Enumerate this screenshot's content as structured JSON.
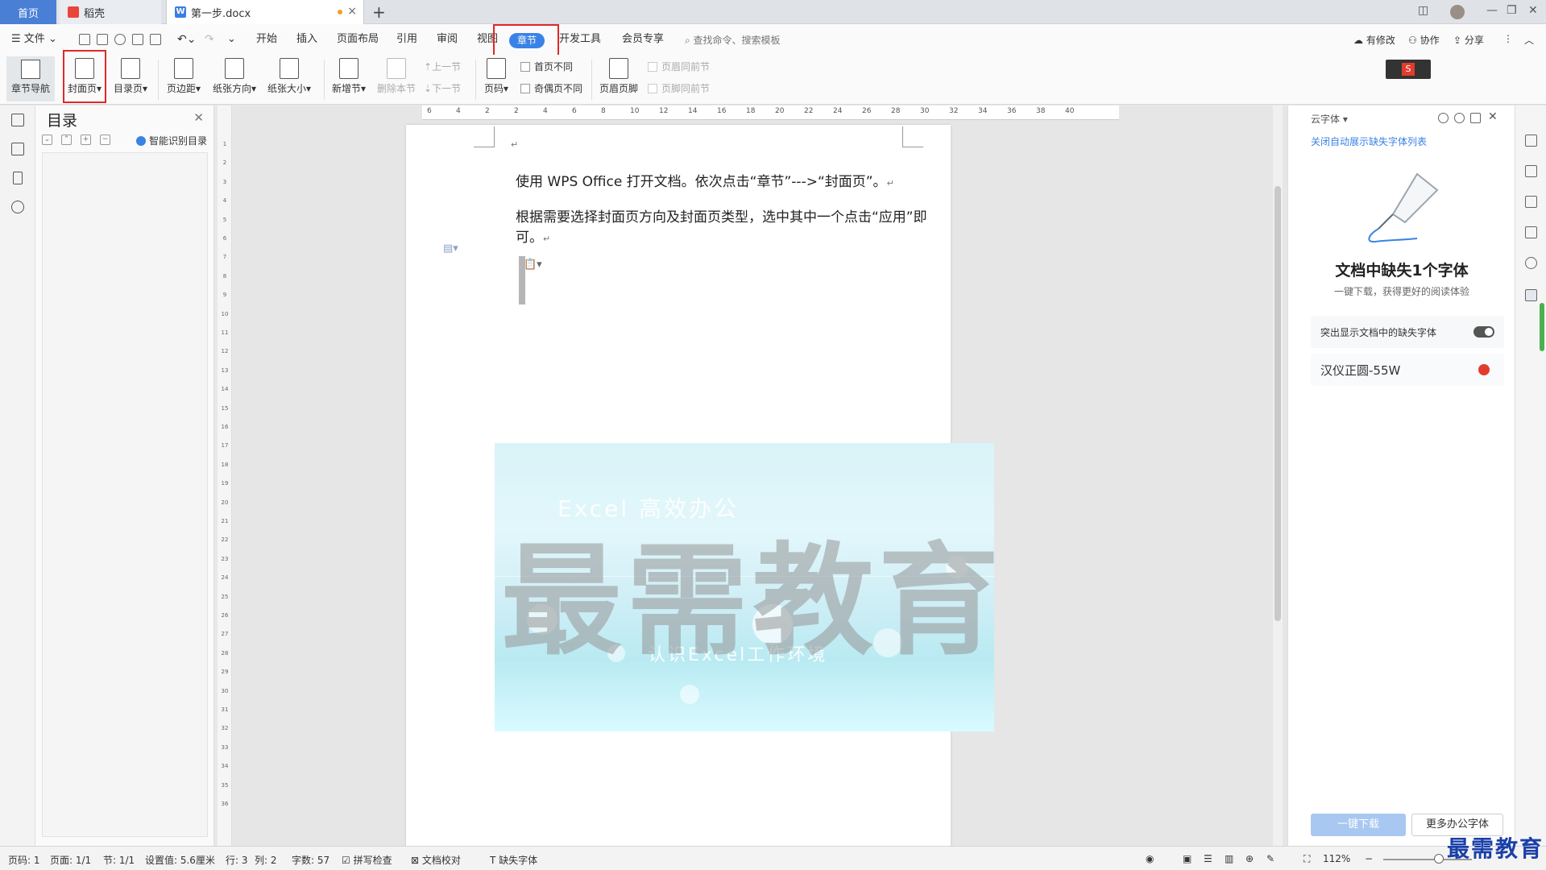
{
  "tabs": {
    "home": "首页",
    "daoke": "稻壳",
    "doc": "第一步.docx"
  },
  "menu": {
    "file": "文件",
    "items": [
      "开始",
      "插入",
      "页面布局",
      "引用",
      "审阅",
      "视图",
      "章节",
      "开发工具",
      "会员专享"
    ],
    "active": "章节",
    "search": "查找命令、搜索模板",
    "modified": "有修改",
    "collab": "协作",
    "share": "分享"
  },
  "ribbon": {
    "chapter_nav": "章节导航",
    "cover_page": "封面页",
    "toc_page": "目录页",
    "margin": "页边距",
    "orientation": "纸张方向",
    "paper_size": "纸张大小",
    "new_section": "新增节",
    "delete_section": "删除本节",
    "prev_section": "上一节",
    "next_section": "下一节",
    "page_number": "页码",
    "first_diff": "首页不同",
    "odd_even_diff": "奇偶页不同",
    "header_footer": "页眉页脚",
    "header_same": "页眉同前节",
    "footer_same": "页脚同前节"
  },
  "toc": {
    "title": "目录",
    "smart": "智能识别目录"
  },
  "document": {
    "line1": "使用 WPS Office 打开文档。依次点击“章节”--->“封面页”。",
    "line2": "根据需要选择封面页方向及封面页类型，选中其中一个点击“应用”即可。",
    "cover_sub1": "Excel 高效办公",
    "cover_sub2": "认识Excel工作环境",
    "watermark": "最需教育"
  },
  "ruler": {
    "h": [
      "6",
      "4",
      "2",
      "2",
      "4",
      "6",
      "8",
      "10",
      "12",
      "14",
      "16",
      "18",
      "20",
      "22",
      "24",
      "26",
      "28",
      "30",
      "32",
      "34",
      "36",
      "38",
      "40"
    ],
    "v": [
      "1",
      "2",
      "3",
      "4",
      "5",
      "6",
      "7",
      "8",
      "9",
      "10",
      "11",
      "12",
      "13",
      "14",
      "15",
      "16",
      "17",
      "18",
      "19",
      "20",
      "21",
      "22",
      "23",
      "24",
      "25",
      "26",
      "27",
      "28",
      "29",
      "30",
      "31",
      "32",
      "33",
      "34",
      "35",
      "36"
    ]
  },
  "right_panel": {
    "title": "云字体",
    "link": "关闭自动展示缺失字体列表",
    "heading": "文档中缺失1个字体",
    "subheading": "一键下载，获得更好的阅读体验",
    "toggle_label": "突出显示文档中的缺失字体",
    "font_name": "汉仪正圆-55W",
    "download": "一键下载",
    "more": "更多办公字体"
  },
  "status": {
    "page_code": "页码: 1",
    "pages": "页面: 1/1",
    "section": "节: 1/1",
    "setting": "设置值: 5.6厘米",
    "row": "行: 3",
    "col": "列: 2",
    "words": "字数: 57",
    "spell": "拼写检查",
    "proof": "文档校对",
    "missing_font": "缺失字体",
    "zoom": "112%"
  },
  "brand_logo": "最需教育",
  "colors": {
    "accent": "#3a82e6",
    "highlight": "#e02828"
  }
}
